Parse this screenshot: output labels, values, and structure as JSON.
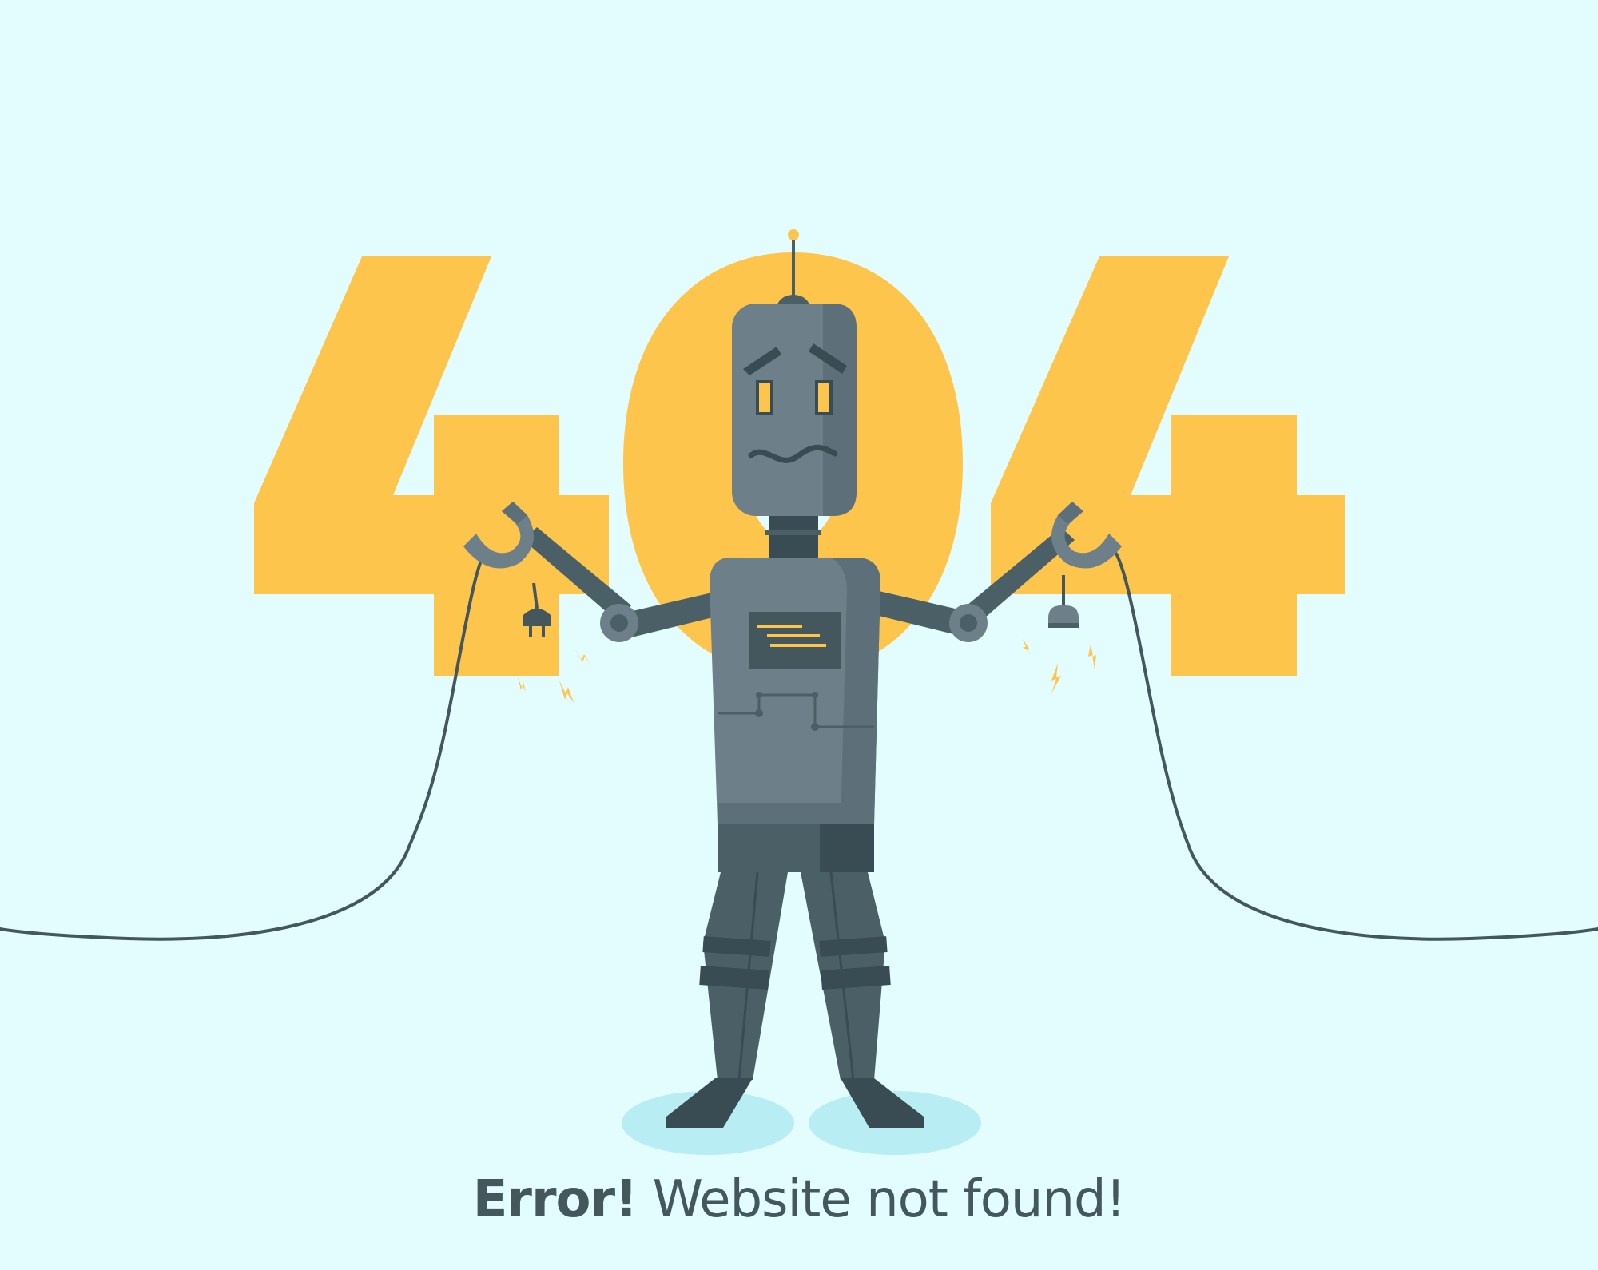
{
  "error_code": {
    "digits": [
      "4",
      "0",
      "4"
    ]
  },
  "message": {
    "strong": "Error!",
    "rest": "Website not found!"
  },
  "illustration": {
    "subject": "robot holding unplugged power cable",
    "icons": [
      "robot-icon",
      "plug-icon",
      "socket-icon",
      "spark-icon",
      "cable-icon"
    ]
  },
  "colors": {
    "background": "#E3FCFD",
    "accent_yellow": "#FDC54C",
    "robot_light": "#6D7F88",
    "robot_mid": "#5D7079",
    "robot_dark": "#4A5F66",
    "robot_darkest": "#3A4C53",
    "text": "#43575D",
    "floor_shadow": "#B7EDF3"
  }
}
